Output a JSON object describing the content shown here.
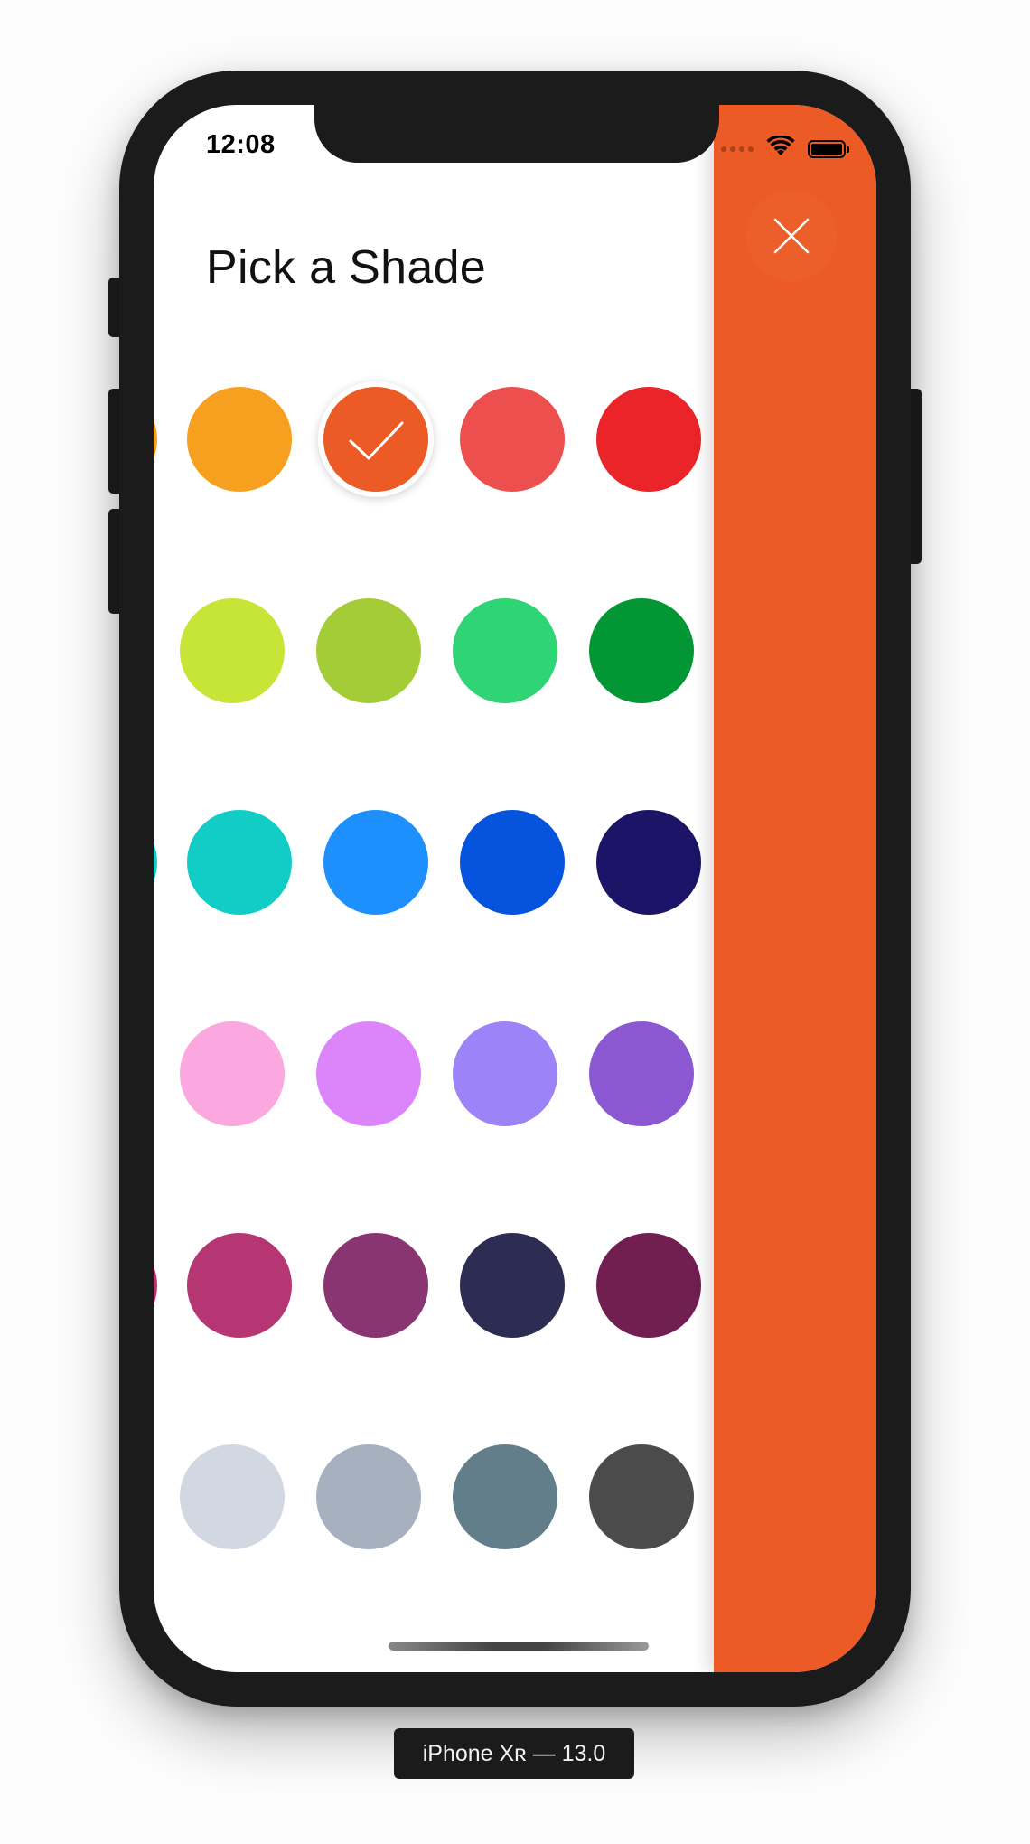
{
  "status_bar": {
    "time": "12:08",
    "icons": [
      "signal-dots-icon",
      "wifi-icon",
      "battery-icon"
    ]
  },
  "screen": {
    "title": "Pick a Shade"
  },
  "palette": [
    {
      "color": "#F7A020",
      "selected": false
    },
    {
      "color": "#EC5A25",
      "selected": true
    },
    {
      "color": "#EC4F4E",
      "selected": false
    },
    {
      "color": "#EA2428",
      "selected": false
    },
    {
      "color": "#C6E536",
      "selected": false
    },
    {
      "color": "#A4CC36",
      "selected": false
    },
    {
      "color": "#2FD574",
      "selected": false
    },
    {
      "color": "#029634",
      "selected": false
    },
    {
      "color": "#12CCC6",
      "selected": false
    },
    {
      "color": "#1E90FD",
      "selected": false
    },
    {
      "color": "#0654DE",
      "selected": false
    },
    {
      "color": "#1C1466",
      "selected": false
    },
    {
      "color": "#FBA8E0",
      "selected": false
    },
    {
      "color": "#DC84FA",
      "selected": false
    },
    {
      "color": "#9C84F8",
      "selected": false
    },
    {
      "color": "#8B58D1",
      "selected": false
    },
    {
      "color": "#B63673",
      "selected": false
    },
    {
      "color": "#883571",
      "selected": false
    },
    {
      "color": "#2D2C53",
      "selected": false
    },
    {
      "color": "#711F51",
      "selected": false
    },
    {
      "color": "#D1D8E1",
      "selected": false
    },
    {
      "color": "#A5B1BE",
      "selected": false
    },
    {
      "color": "#627E8B",
      "selected": false
    },
    {
      "color": "#4B4B4B",
      "selected": false
    }
  ],
  "side_panel": {
    "color": "#EC5A25",
    "close_icon": "close-icon"
  },
  "simulator": {
    "device_label": "iPhone Xʀ — 13.0"
  }
}
